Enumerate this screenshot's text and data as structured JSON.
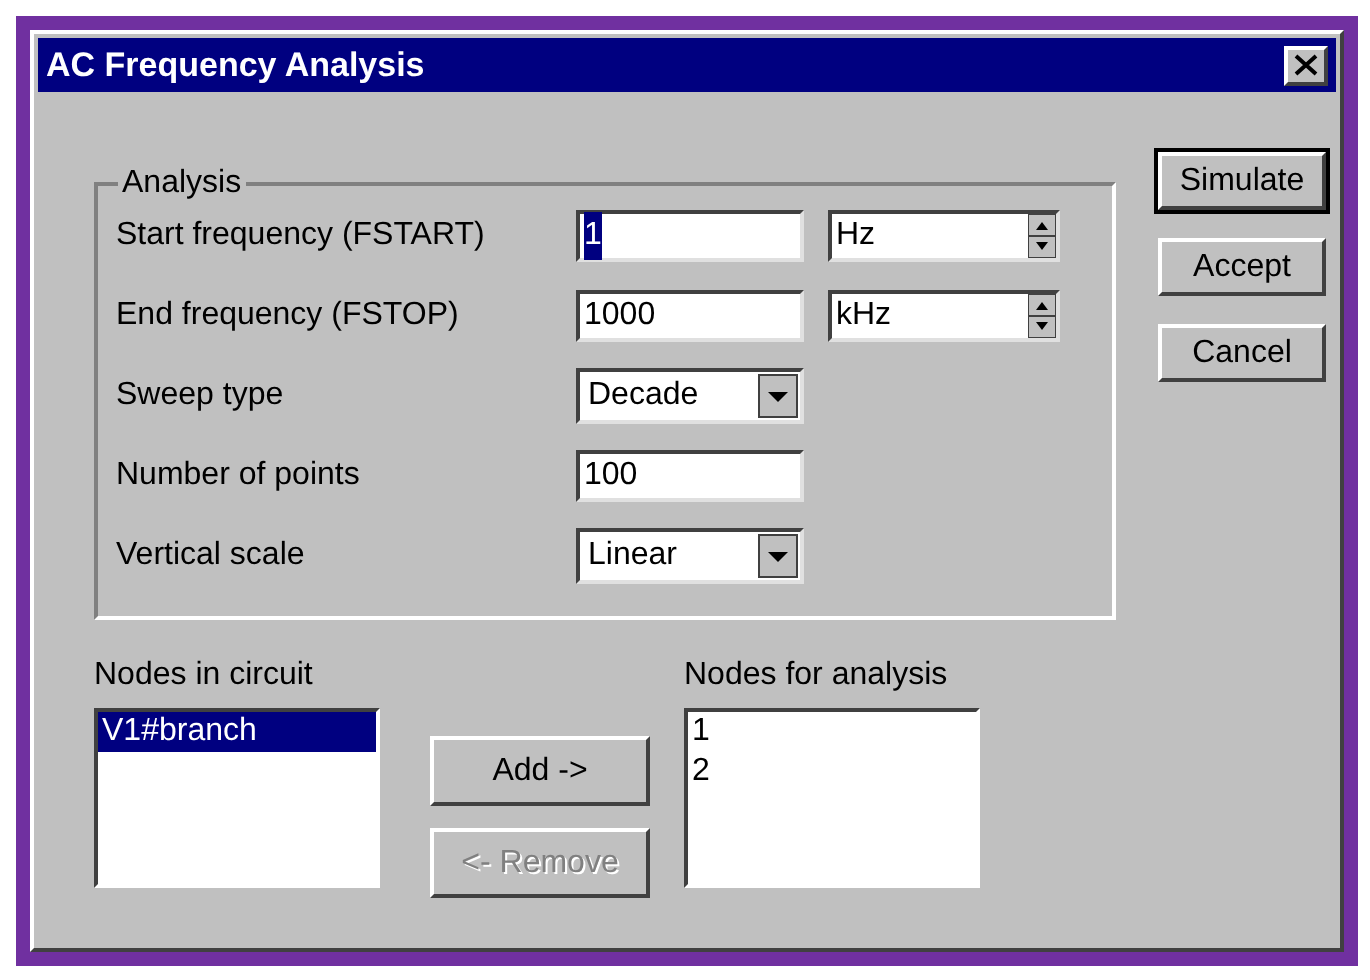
{
  "window": {
    "title": "AC Frequency Analysis"
  },
  "analysis": {
    "legend": "Analysis",
    "fields": [
      {
        "kind": "spin",
        "label": "Start frequency (FSTART)",
        "value": "1",
        "text_selected": true,
        "unit": "Hz"
      },
      {
        "kind": "spin",
        "label": "End frequency (FSTOP)",
        "value": "1000",
        "text_selected": false,
        "unit": "kHz"
      },
      {
        "kind": "select",
        "label": "Sweep type",
        "value": "Decade"
      },
      {
        "kind": "text",
        "label": "Number of points",
        "value": "100",
        "text_selected": false
      },
      {
        "kind": "select",
        "label": "Vertical scale",
        "value": "Linear"
      }
    ]
  },
  "side_buttons": [
    {
      "label": "Simulate",
      "default": true,
      "disabled": false
    },
    {
      "label": "Accept",
      "default": false,
      "disabled": false
    },
    {
      "label": "Cancel",
      "default": false,
      "disabled": false
    }
  ],
  "nodes_in_circuit": {
    "label": "Nodes in circuit",
    "items": [
      {
        "text": "V1#branch",
        "selected": true
      }
    ]
  },
  "transfer_buttons": [
    {
      "label": "Add ->",
      "disabled": false
    },
    {
      "label": "<- Remove",
      "disabled": true
    }
  ],
  "nodes_for_analysis": {
    "label": "Nodes for analysis",
    "items": [
      {
        "text": "1",
        "selected": false
      },
      {
        "text": "2",
        "selected": false
      }
    ]
  }
}
